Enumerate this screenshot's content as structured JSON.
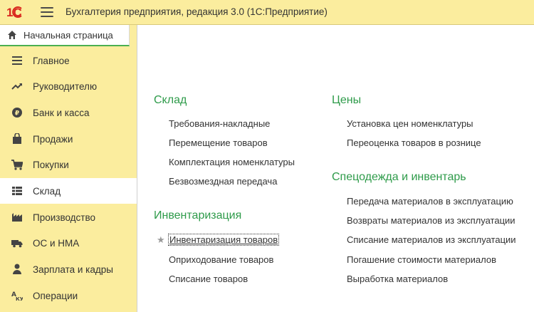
{
  "app": {
    "logo_text": "1С",
    "title": "Бухгалтерия предприятия, редакция 3.0  (1С:Предприятие)"
  },
  "home_tab": {
    "label": "Начальная страница"
  },
  "sidebar": {
    "items": [
      {
        "label": "Главное",
        "icon": "list-icon"
      },
      {
        "label": "Руководителю",
        "icon": "trend-icon"
      },
      {
        "label": "Банк и касса",
        "icon": "coin-icon"
      },
      {
        "label": "Продажи",
        "icon": "shopping-bag-icon"
      },
      {
        "label": "Покупки",
        "icon": "cart-icon"
      },
      {
        "label": "Склад",
        "icon": "warehouse-icon",
        "active": true
      },
      {
        "label": "Производство",
        "icon": "factory-icon"
      },
      {
        "label": "ОС и НМА",
        "icon": "truck-icon"
      },
      {
        "label": "Зарплата и кадры",
        "icon": "person-icon"
      },
      {
        "label": "Операции",
        "icon": "operations-icon"
      }
    ]
  },
  "main": {
    "left_column": [
      {
        "title": "Склад",
        "links": [
          "Требования-накладные",
          "Перемещение товаров",
          "Комплектация номенклатуры",
          "Безвозмездная передача"
        ]
      },
      {
        "title": "Инвентаризация",
        "links": [
          "Инвентаризация товаров",
          "Оприходование товаров",
          "Списание товаров"
        ]
      }
    ],
    "right_column": [
      {
        "title": "Цены",
        "links": [
          "Установка цен номенклатуры",
          "Переоценка товаров в рознице"
        ]
      },
      {
        "title": "Спецодежда и инвентарь",
        "links": [
          "Передача материалов в эксплуатацию",
          "Возвраты материалов из эксплуатации",
          "Списание материалов из эксплуатации",
          "Погашение стоимости материалов",
          "Выработка материалов"
        ]
      }
    ]
  },
  "colors": {
    "accent_yellow": "#fbed9e",
    "section_green": "#2e9b4a",
    "logo_red": "#d9281e"
  }
}
